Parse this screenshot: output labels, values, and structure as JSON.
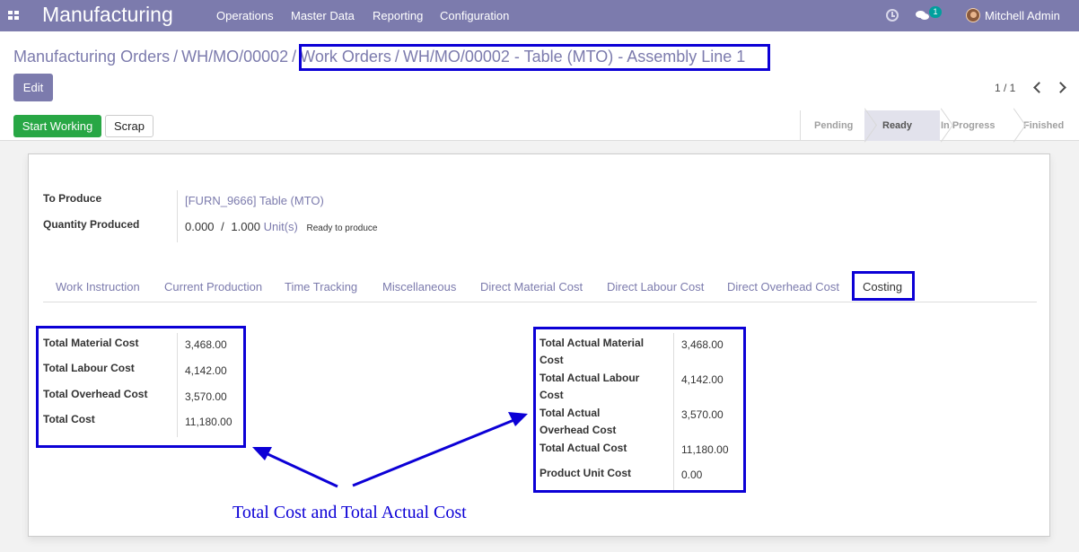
{
  "navbar": {
    "brand": "Manufacturing",
    "menu": [
      "Operations",
      "Master Data",
      "Reporting",
      "Configuration"
    ],
    "messages_count": "1",
    "user_name": "Mitchell Admin"
  },
  "breadcrumb": {
    "items": [
      "Manufacturing Orders",
      "WH/MO/00002",
      "Work Orders"
    ],
    "separator": "/",
    "current": "WH/MO/00002 - Table (MTO) - Assembly Line 1"
  },
  "control": {
    "edit_label": "Edit",
    "pager": "1 / 1"
  },
  "statusbar": {
    "start_label": "Start Working",
    "scrap_label": "Scrap",
    "stages": [
      "Pending",
      "Ready",
      "In Progress",
      "Finished"
    ],
    "current_stage": "Ready"
  },
  "form": {
    "to_produce_label": "To Produce",
    "to_produce_value": "[FURN_9666] Table (MTO)",
    "qty_label": "Quantity Produced",
    "qty_done": "0.000",
    "qty_sep": "/",
    "qty_total": "1.000",
    "qty_uom": "Unit(s)",
    "qty_state": "Ready to produce"
  },
  "tabs": [
    "Work Instruction",
    "Current Production",
    "Time Tracking",
    "Miscellaneous",
    "Direct Material Cost",
    "Direct Labour Cost",
    "Direct Overhead Cost",
    "Costing"
  ],
  "active_tab": "Costing",
  "costs": [
    {
      "label": "Total Material Cost",
      "value": "3,468.00"
    },
    {
      "label": "Total Labour Cost",
      "value": "4,142.00"
    },
    {
      "label": "Total Overhead Cost",
      "value": "3,570.00"
    },
    {
      "label": "Total Cost",
      "value": "11,180.00"
    }
  ],
  "actual_costs": [
    {
      "label": "Total Actual Material Cost",
      "value": "3,468.00"
    },
    {
      "label": "Total Actual Labour Cost",
      "value": "4,142.00"
    },
    {
      "label": "Total Actual Overhead Cost",
      "value": "3,570.00"
    },
    {
      "label": "Total Actual Cost",
      "value": "11,180.00"
    },
    {
      "label": "Product Unit Cost",
      "value": "0.00"
    }
  ],
  "annotation": "Total Cost and Total Actual Cost",
  "colors": {
    "brand": "#7c7bad",
    "highlight": "#0c00d6",
    "start_button": "#28a745"
  }
}
